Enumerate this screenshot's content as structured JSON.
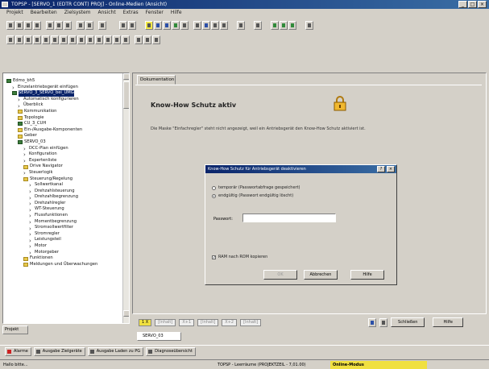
{
  "window": {
    "title": "TOPSP - [SERVO_1 (EDTR CONT) PROJ] - Online-Medien (Ansicht)",
    "controls": [
      "_",
      "□",
      "×"
    ]
  },
  "menubar": [
    "Projekt",
    "Bearbeiten",
    "Zielsystem",
    "Ansicht",
    "Extras",
    "Fenster",
    "Hilfe"
  ],
  "tree": {
    "items": [
      {
        "label": "Edmo_bh5",
        "level": 0,
        "icon": "drive"
      },
      {
        "label": "Einzelantriebsgerät einfügen",
        "level": 1,
        "icon": "arrow"
      },
      {
        "label": "SERVO_3_SERVO_bei_UMG",
        "level": 1,
        "icon": "drive",
        "selected": true
      },
      {
        "label": "Automatisch konfigurieren",
        "level": 2,
        "icon": "arrow"
      },
      {
        "label": "Überblick",
        "level": 2,
        "icon": "arrow"
      },
      {
        "label": "Kommunikation",
        "level": 2,
        "icon": "folder"
      },
      {
        "label": "Topologie",
        "level": 2,
        "icon": "folder"
      },
      {
        "label": "CU_3_CUH",
        "level": 2,
        "icon": "drive"
      },
      {
        "label": "Ein-/Ausgabe-Komponenten",
        "level": 2,
        "icon": "folder"
      },
      {
        "label": "Geber",
        "level": 2,
        "icon": "folder"
      },
      {
        "label": "SERVO_03",
        "level": 2,
        "icon": "drive"
      },
      {
        "label": "DCC-Plan einfügen",
        "level": 3,
        "icon": "arrow"
      },
      {
        "label": "Konfiguration",
        "level": 3,
        "icon": "arrow"
      },
      {
        "label": "Expertenliste",
        "level": 3,
        "icon": "arrow"
      },
      {
        "label": "Drive Navigator",
        "level": 3,
        "icon": "folder"
      },
      {
        "label": "Steuerlogik",
        "level": 3,
        "icon": "arrow"
      },
      {
        "label": "Steuerung/Regelung",
        "level": 3,
        "icon": "folder"
      },
      {
        "label": "Sollwertkanal",
        "level": 4,
        "icon": "arrow"
      },
      {
        "label": "Drehzahlsteuerung",
        "level": 4,
        "icon": "arrow"
      },
      {
        "label": "Drehzahlbegrenzung",
        "level": 4,
        "icon": "arrow"
      },
      {
        "label": "Drehzahlregler",
        "level": 4,
        "icon": "arrow"
      },
      {
        "label": "WT-Steuerung",
        "level": 4,
        "icon": "arrow"
      },
      {
        "label": "Flussfunktionen",
        "level": 4,
        "icon": "arrow"
      },
      {
        "label": "Momentbegrenzung",
        "level": 4,
        "icon": "arrow"
      },
      {
        "label": "Stromsollwertfilter",
        "level": 4,
        "icon": "arrow"
      },
      {
        "label": "Stromregler",
        "level": 4,
        "icon": "arrow"
      },
      {
        "label": "Leistungsteil",
        "level": 4,
        "icon": "arrow"
      },
      {
        "label": "Motor",
        "level": 4,
        "icon": "arrow"
      },
      {
        "label": "Motorgeber",
        "level": 4,
        "icon": "arrow"
      },
      {
        "label": "Funktionen",
        "level": 3,
        "icon": "folder"
      },
      {
        "label": "Meldungen und Überwachungen",
        "level": 3,
        "icon": "folder"
      }
    ]
  },
  "left_tab": "Projekt",
  "main": {
    "tab_label": "Dokumentation",
    "heading": "Know-How Schutz aktiv",
    "description": "Die Maske \"Einfachregler\" steht nicht angezeigt, weil ein Antriebsgerät den Know-How Schutz aktiviert ist.",
    "page_buttons": [
      "1 X",
      "[Inhalt]",
      "X+1",
      "[Inhalt]",
      "X+2",
      "[Inhalt]"
    ],
    "schliessen_label": "Schließen",
    "hilfe_label": "Hilfe",
    "doc_tab_label": "SERVO_03"
  },
  "dialog": {
    "title": "Know-How Schutz für Antriebsgerät deaktivieren",
    "option1": "temporär (Passwortabfrage gespeichert)",
    "option2": "endgültig (Passwort endgültig löscht)",
    "password_label": "Passwort:",
    "password_value": "",
    "checkbox_label": "RAM nach ROM kopieren",
    "btn_ok": "OK",
    "btn_cancel": "Abbrechen",
    "btn_help": "Hilfe",
    "icon_help": "?",
    "icon_close": "×"
  },
  "taskbar": [
    "Alarme",
    "Ausgabe Zielgeräte",
    "Ausgabe Laden zu PG",
    "Diagnoseübersicht"
  ],
  "status": {
    "left": "Hallo bitte...",
    "middle": "TOPSP - Leerräume (PROJEKTZEIL - 7,01.00)",
    "mode": "Online-Modus"
  },
  "colors": {
    "title_start": "#0a246a",
    "title_end": "#3a6ea5",
    "online_mode": "#f0e040"
  }
}
